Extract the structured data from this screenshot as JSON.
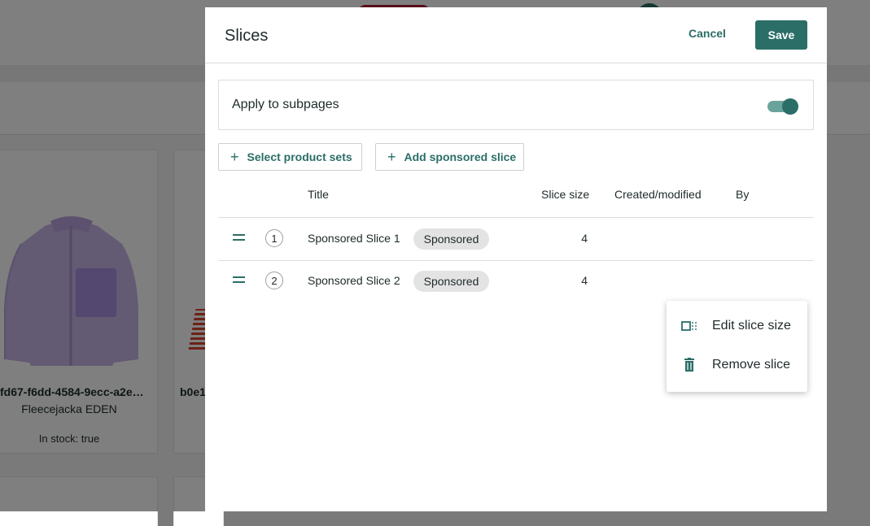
{
  "background": {
    "product_card": {
      "id": "fd67-f6dd-4584-9ecc-a2e…",
      "name": "Fleecejacka EDEN",
      "stock": "In stock: true"
    },
    "product_card_2": {
      "id": "b0e1"
    }
  },
  "modal": {
    "title": "Slices",
    "cancel_label": "Cancel",
    "save_label": "Save",
    "apply_subpages": {
      "label": "Apply to subpages",
      "enabled": true
    },
    "select_product_sets_label": "Select product sets",
    "add_sponsored_slice_label": "Add sponsored slice",
    "plus_glyph": "+",
    "table": {
      "columns": [
        "Title",
        "Slice size",
        "Created/modified",
        "By"
      ],
      "rows": [
        {
          "index": "1",
          "title": "Sponsored Slice 1",
          "badge": "Sponsored",
          "slice_size": "4",
          "created": "",
          "by": ""
        },
        {
          "index": "2",
          "title": "Sponsored Slice 2",
          "badge": "Sponsored",
          "slice_size": "4",
          "created": "",
          "by": ""
        }
      ]
    }
  },
  "context_menu": {
    "items": [
      {
        "label": "Edit slice size",
        "icon": "resize-icon"
      },
      {
        "label": "Remove slice",
        "icon": "trash-icon"
      }
    ]
  },
  "colors": {
    "accent": "#2b6e67",
    "toggle_track": "#6aa39c",
    "badge_bg": "#e3e3e3",
    "overlay": "rgba(0,0,0,0.5)"
  }
}
